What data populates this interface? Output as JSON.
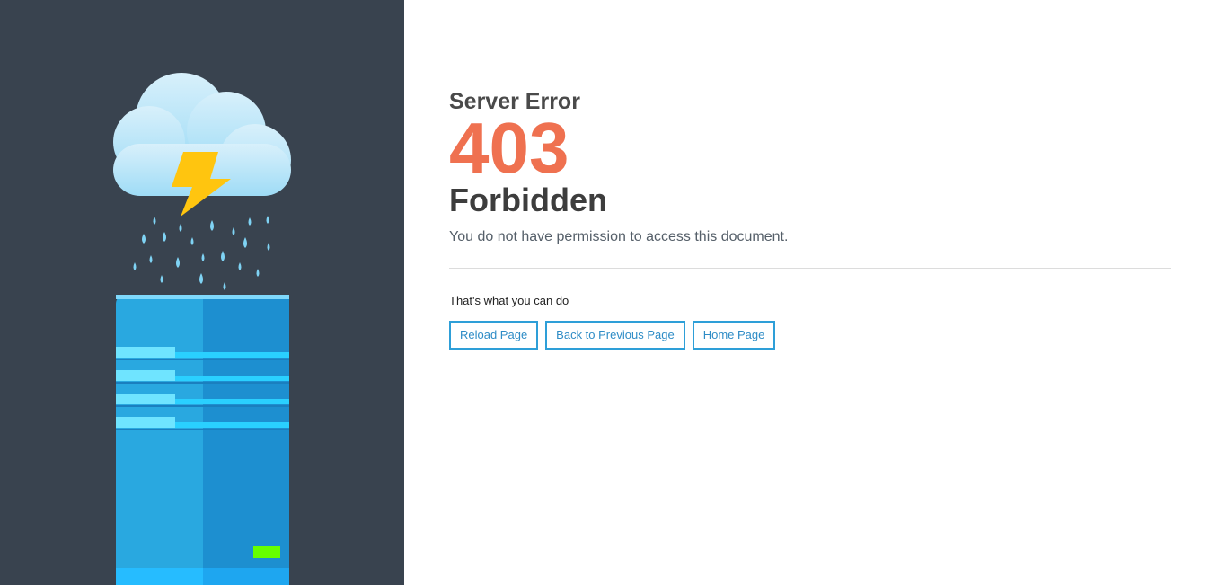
{
  "header": {
    "subtitle": "Server Error",
    "code": "403",
    "title": "Forbidden",
    "description": "You do not have permission to access this document."
  },
  "actions": {
    "heading": "That's what you can do",
    "reload_label": "Reload Page",
    "back_label": "Back to Previous Page",
    "home_label": "Home Page"
  },
  "colors": {
    "panel_bg": "#39434f",
    "accent_code": "#ef7150",
    "button_border": "#2e9fd8",
    "server_light": "#29a8e0",
    "server_dark": "#1d8fd0",
    "status_led": "#66ff00",
    "bolt": "#ffc50f"
  },
  "illustration": {
    "icons": [
      "cloud-icon",
      "lightning-icon",
      "raindrop-icon",
      "server-icon",
      "status-led-icon"
    ]
  }
}
